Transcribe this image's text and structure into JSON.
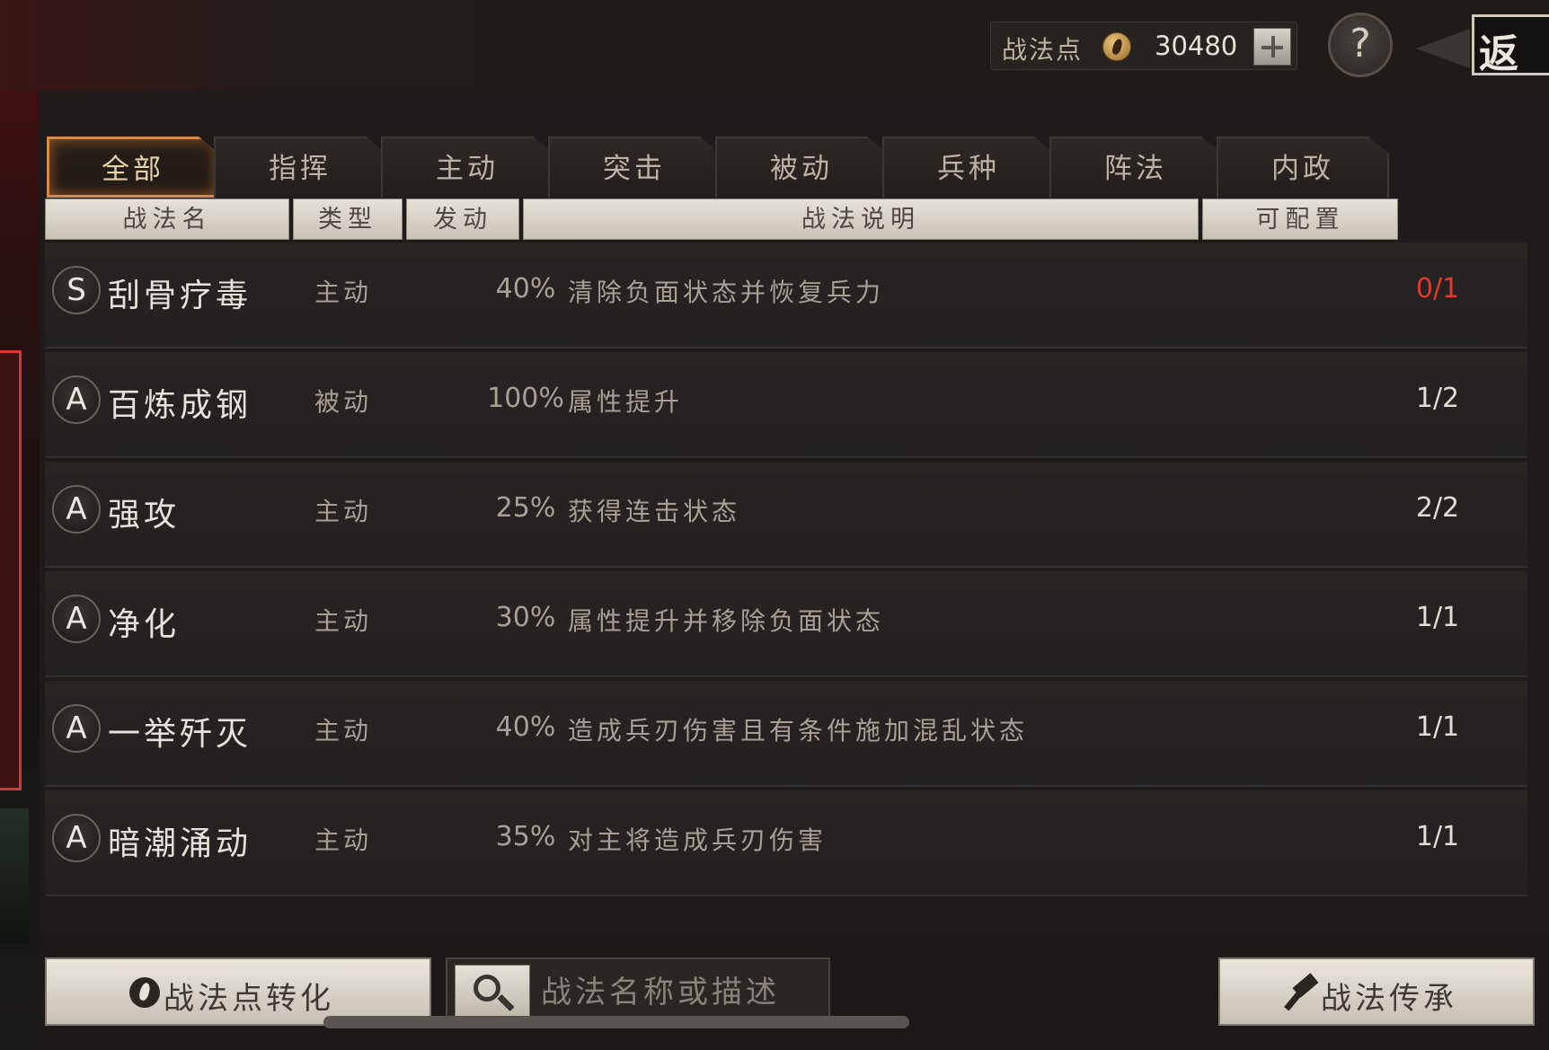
{
  "topbar": {
    "points_label": "战法点",
    "points_value": "30480",
    "help_label": "?",
    "back_label": "返回"
  },
  "tabs": [
    {
      "label": "全部",
      "active": true
    },
    {
      "label": "指挥"
    },
    {
      "label": "主动"
    },
    {
      "label": "突击"
    },
    {
      "label": "被动"
    },
    {
      "label": "兵种"
    },
    {
      "label": "阵法"
    },
    {
      "label": "内政"
    }
  ],
  "header": {
    "name": "战法名",
    "type": "类型",
    "rate": "发动",
    "desc": "战法说明",
    "count": "可配置"
  },
  "skills": [
    {
      "grade": "S",
      "name": "刮骨疗毒",
      "type": "主动",
      "rate": "40%",
      "desc": "清除负面状态并恢复兵力",
      "count": "0/1",
      "count_color": "#e0392f"
    },
    {
      "grade": "A",
      "name": "百炼成钢",
      "type": "被动",
      "rate": "100%",
      "desc": "属性提升",
      "count": "1/2"
    },
    {
      "grade": "A",
      "name": "强攻",
      "type": "主动",
      "rate": "25%",
      "desc": "获得连击状态",
      "count": "2/2"
    },
    {
      "grade": "A",
      "name": "净化",
      "type": "主动",
      "rate": "30%",
      "desc": "属性提升并移除负面状态",
      "count": "1/1"
    },
    {
      "grade": "A",
      "name": "一举歼灭",
      "type": "主动",
      "rate": "40%",
      "desc": "造成兵刃伤害且有条件施加混乱状态",
      "count": "1/1"
    },
    {
      "grade": "A",
      "name": "暗潮涌动",
      "type": "主动",
      "rate": "35%",
      "desc": "对主将造成兵刃伤害",
      "count": "1/1"
    }
  ],
  "bottom": {
    "convert_label": "战法点转化",
    "search_placeholder": "战法名称或描述",
    "inherit_label": "战法传承"
  },
  "colors": {
    "active_tab_border": "#d58a4e",
    "count_full": "#e0392f"
  }
}
